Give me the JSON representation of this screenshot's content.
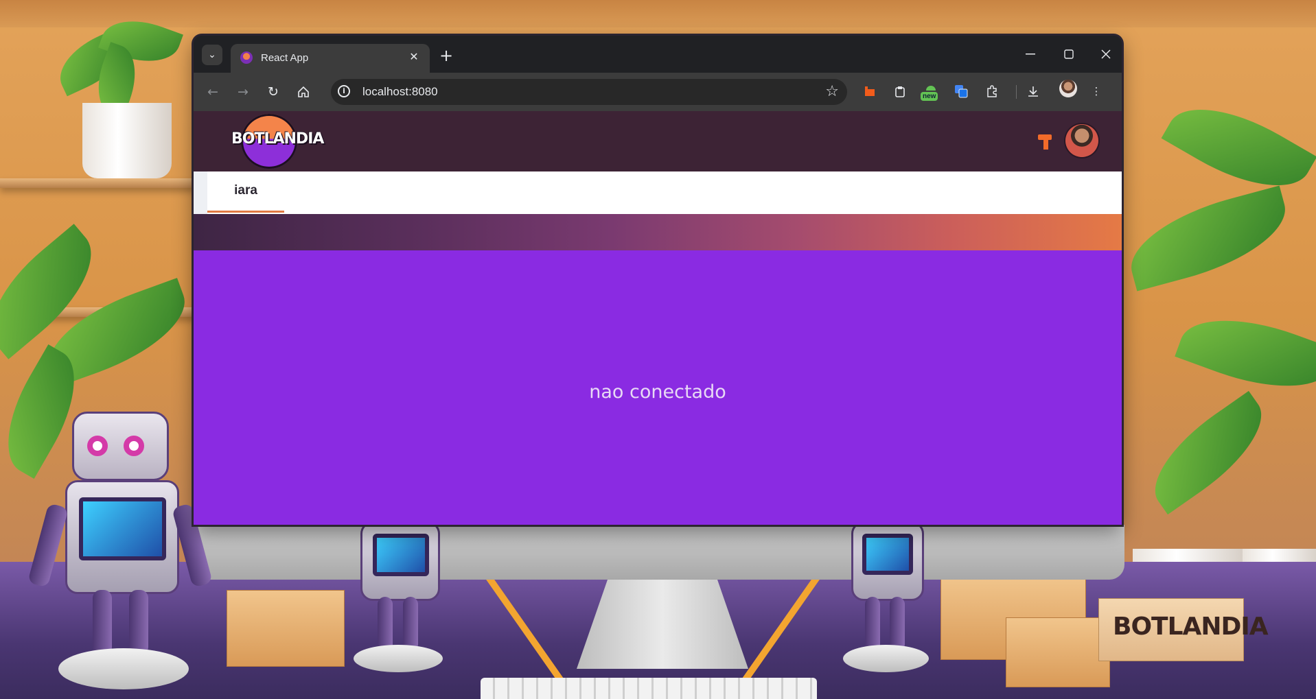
{
  "browser": {
    "tab_title": "React App",
    "url": "localhost:8080",
    "extension_badge": "new"
  },
  "app": {
    "logo_text": "BOTLANDIA",
    "tabs": [
      {
        "label": "iara",
        "active": true
      }
    ],
    "status_message": "nao conectado",
    "colors": {
      "appbar": "#3d2335",
      "content": "#8a2be2",
      "accent": "#e07a43"
    }
  },
  "background": {
    "box_label": "BOTLANDIA"
  },
  "icons": {
    "tab_search": "chevron-down-icon",
    "close_tab": "close-icon",
    "new_tab": "plus-icon",
    "minimize": "minimize-icon",
    "maximize": "maximize-icon",
    "close_window": "close-icon",
    "back": "arrow-left-icon",
    "forward": "arrow-right-icon",
    "reload": "reload-icon",
    "home": "home-icon",
    "site_info": "info-icon",
    "bookmark": "star-icon",
    "downloads": "download-icon",
    "menu": "kebab-menu-icon",
    "tools": "hammer-icon"
  }
}
